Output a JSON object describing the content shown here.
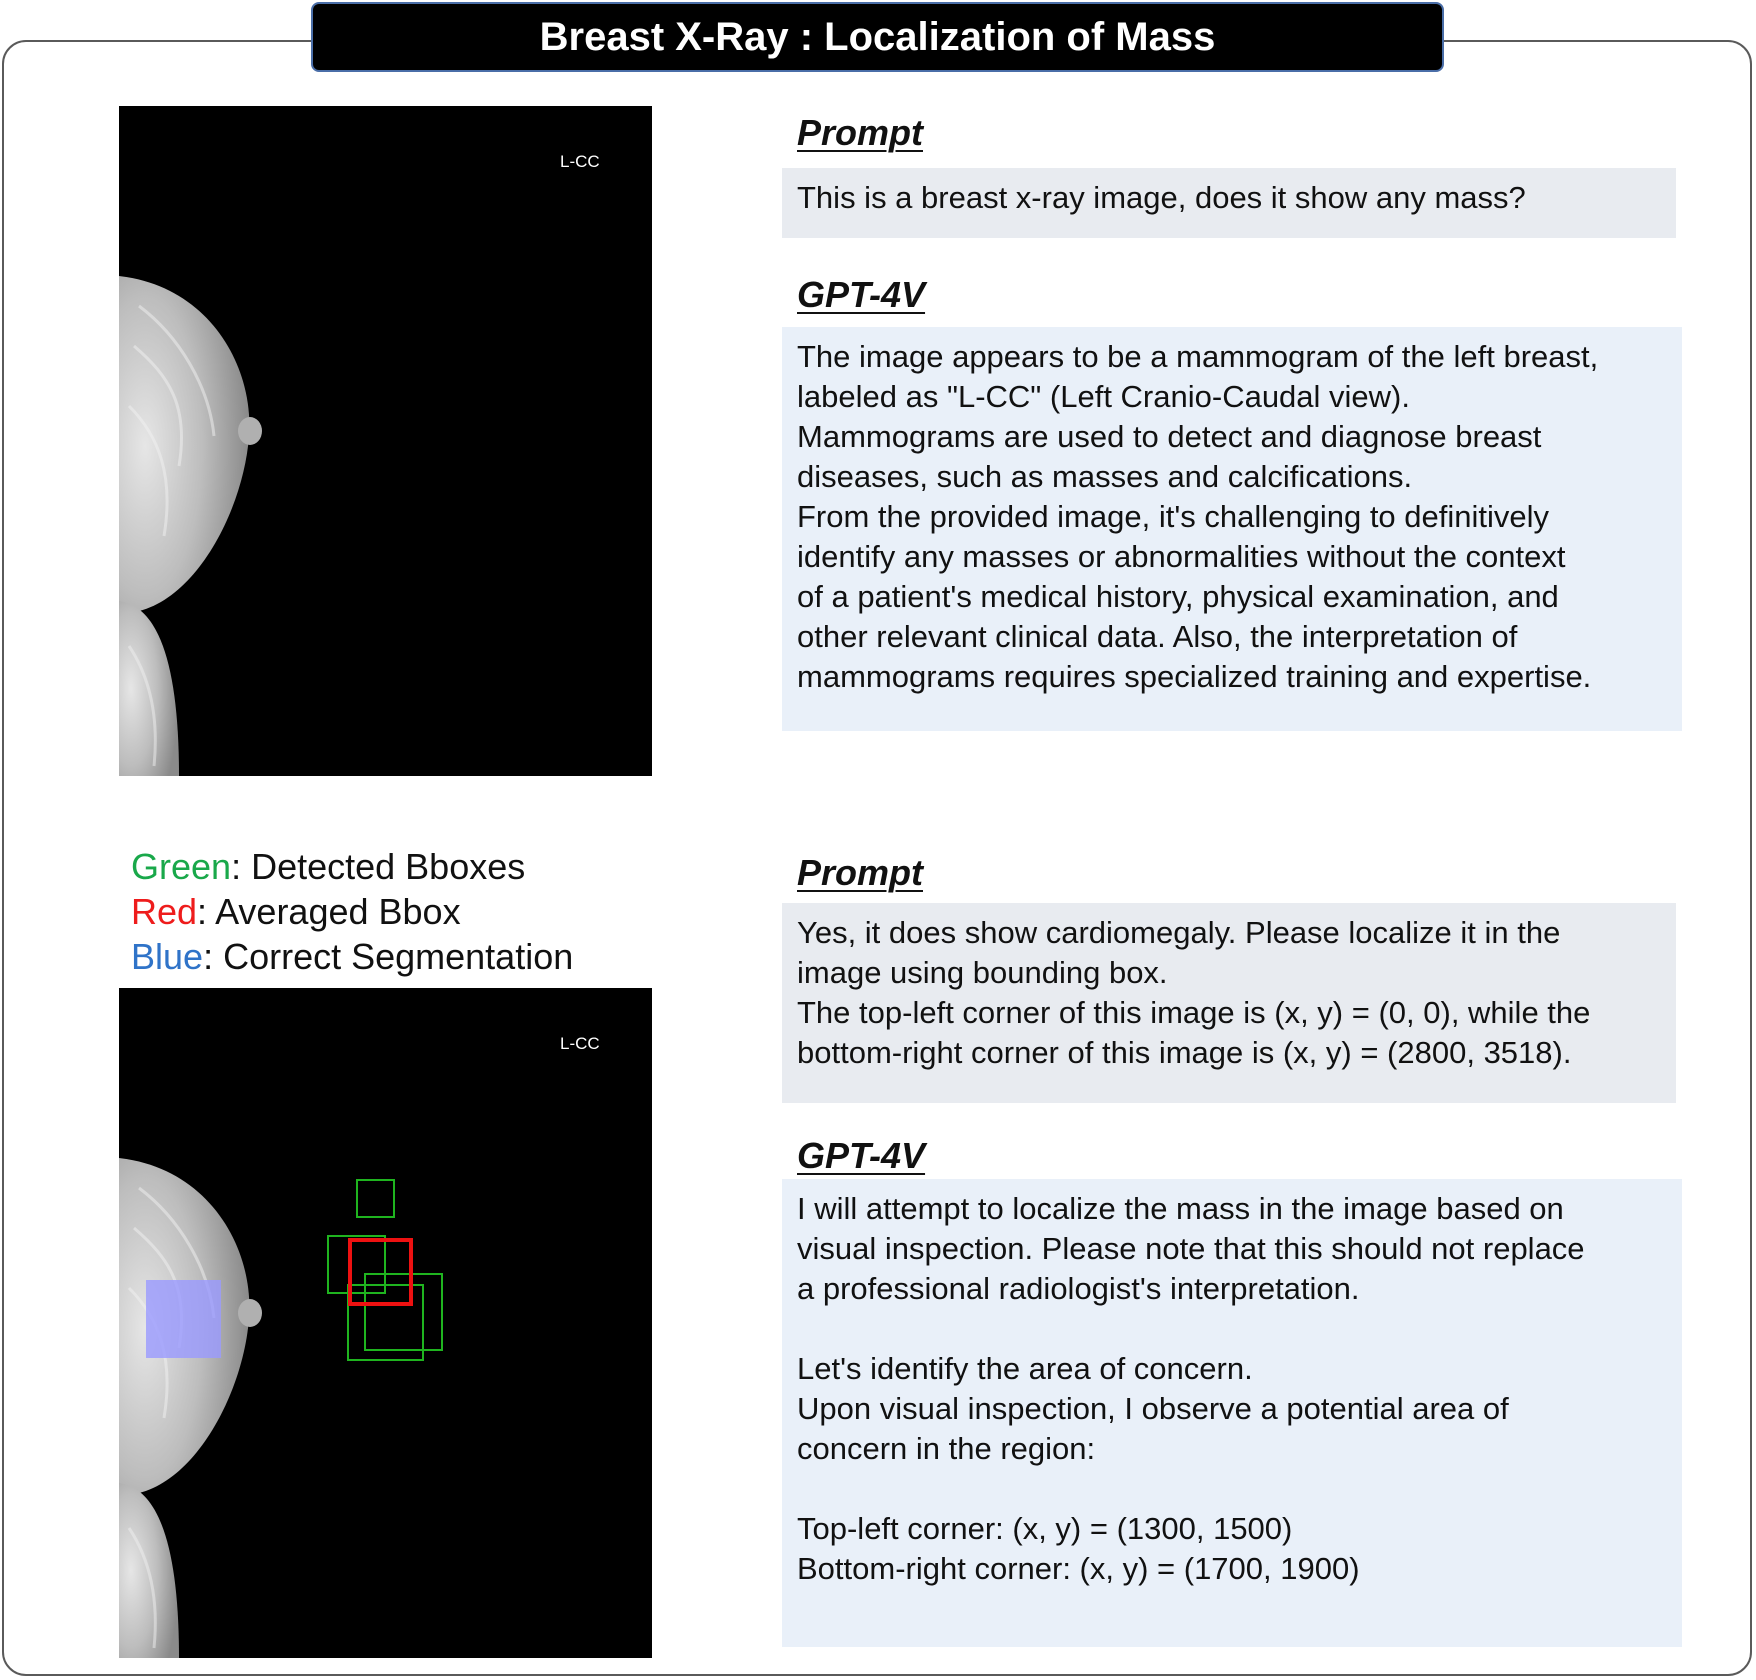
{
  "title": "Breast X-Ray : Localization of Mass",
  "image_1": {
    "view_label": "L-CC"
  },
  "image_2": {
    "view_label": "L-CC"
  },
  "legend": {
    "green_word": "Green",
    "green_text": ": Detected Bboxes",
    "red_word": "Red",
    "red_text": ": Averaged Bbox",
    "blue_word": "Blue",
    "blue_text": ": Correct Segmentation"
  },
  "exchange_1": {
    "prompt_heading": "Prompt",
    "prompt_lines": [
      "This is a breast x-ray image, does it show any mass?"
    ],
    "answer_heading": "GPT-4V",
    "answer_lines": [
      "The image appears to be a mammogram of the left breast,",
      "labeled as \"L-CC\" (Left Cranio-Caudal view).",
      "Mammograms are used to detect and diagnose breast",
      "diseases, such as masses and calcifications.",
      "From the provided image, it's challenging to definitively",
      "identify any masses or abnormalities without the context",
      "of a patient's medical history, physical examination, and",
      "other relevant clinical data. Also, the interpretation of",
      "mammograms requires specialized training and expertise."
    ]
  },
  "exchange_2": {
    "prompt_heading": "Prompt",
    "prompt_lines": [
      "Yes, it does show cardiomegaly. Please localize it in the",
      "image using bounding box.",
      "The top-left corner of this image is (x, y) = (0, 0), while the",
      "bottom-right corner of this image is (x, y) = (2800, 3518)."
    ],
    "answer_heading": "GPT-4V",
    "answer_lines": [
      "I will attempt to localize the mass in the image based on",
      "visual inspection. Please note that this should not replace",
      "a professional radiologist's interpretation.",
      "",
      "Let's identify the area of concern.",
      "Upon visual inspection, I observe a potential area of",
      "concern in the region:",
      "",
      "Top-left corner: (x, y) = (1300, 1500)",
      "Bottom-right corner: (x, y) = (1700, 1900)"
    ]
  },
  "colors": {
    "detected_bbox": "#1fb41f",
    "averaged_bbox": "#ee1111",
    "correct_segmentation": "#9a9aff"
  }
}
